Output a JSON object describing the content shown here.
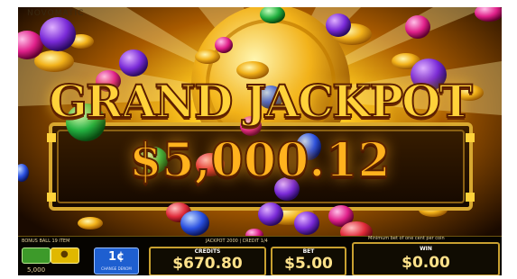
{
  "top_strip_text": "NOVOMATIC",
  "jackpot": {
    "title": "GRAND JACKPOT",
    "amount": "$5,000.12"
  },
  "status_bar": {
    "left_info": "BONUS BALL 19 ITEM",
    "middle_info": "JACKPOT 2000 | CREDIT 1/4",
    "right_info": "Minimum bet of one cent per coin",
    "balance_small": "5,000",
    "denom_value": "1¢",
    "denom_caption": "CHANGE DENOM",
    "credits_label": "CREDITS",
    "credits_value": "$670.80",
    "bet_label": "BET",
    "bet_value": "$5.00",
    "win_label": "WIN",
    "win_value": "$0.00"
  },
  "colors": {
    "gold": "#ffd23a",
    "bar_border": "#c8a030",
    "green_button": "#3d9a2a",
    "yellow_button": "#e0b800",
    "blue_button": "#1e5fd0"
  },
  "icons": [
    "coin-icon",
    "gem-icon",
    "speaker-icon"
  ]
}
